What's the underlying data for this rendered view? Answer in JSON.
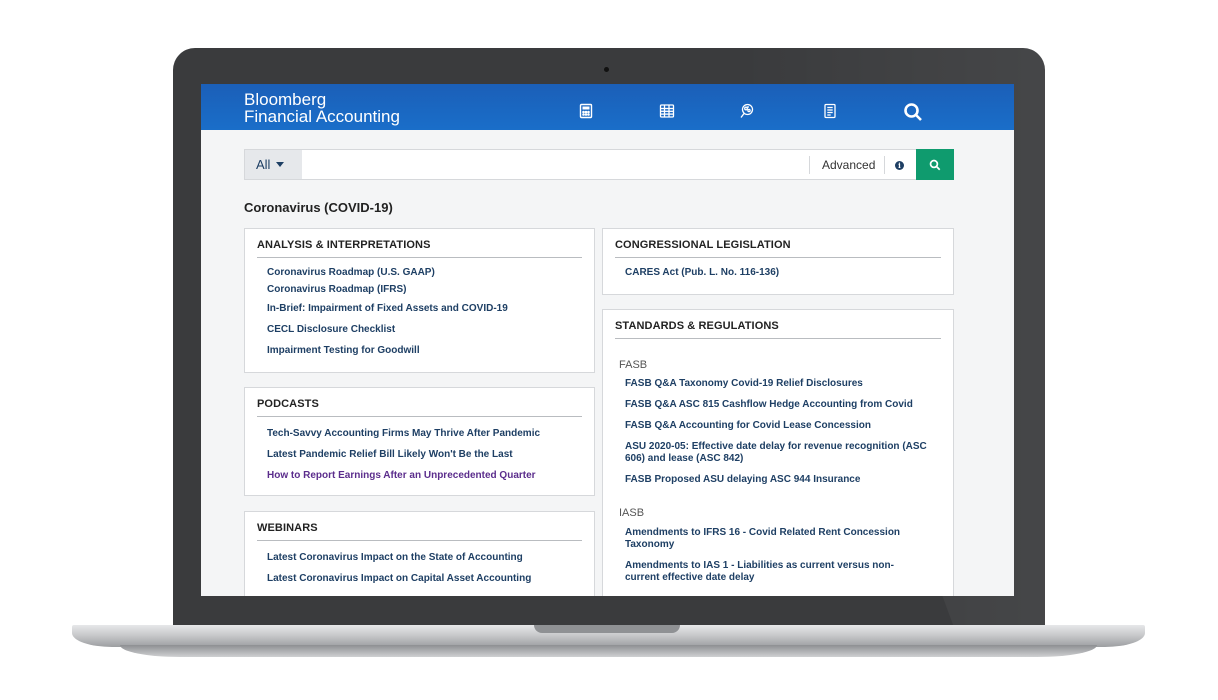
{
  "brand": {
    "line1": "Bloomberg",
    "line2": "Financial Accounting"
  },
  "nav_icons": [
    "calculator-icon",
    "table-icon",
    "brain-icon",
    "document-icon",
    "search-icon"
  ],
  "search": {
    "scope": "All",
    "placeholder": "",
    "advanced": "Advanced"
  },
  "page_title": "Coronavirus (COVID-19)",
  "analysis": {
    "heading": "ANALYSIS & INTERPRETATIONS",
    "links": [
      "Coronavirus Roadmap (U.S. GAAP)",
      "Coronavirus Roadmap (IFRS)",
      "In-Brief: Impairment of Fixed Assets and COVID-19",
      "CECL Disclosure Checklist",
      "Impairment Testing for Goodwill"
    ]
  },
  "podcasts": {
    "heading": "PODCASTS",
    "links": [
      "Tech-Savvy Accounting Firms May Thrive After Pandemic",
      "Latest Pandemic Relief Bill Likely Won't Be the Last",
      "How to Report Earnings After an Unprecedented Quarter"
    ]
  },
  "webinars": {
    "heading": "WEBINARS",
    "links": [
      "Latest Coronavirus Impact on the State of Accounting",
      "Latest Coronavirus Impact on Capital Asset Accounting"
    ]
  },
  "legislation": {
    "heading": "CONGRESSIONAL LEGISLATION",
    "links": [
      "CARES Act (Pub. L. No. 116-136)"
    ]
  },
  "standards": {
    "heading": "STANDARDS & REGULATIONS",
    "fasb": {
      "label": "FASB",
      "links": [
        "FASB Q&A Taxonomy Covid-19 Relief Disclosures",
        "FASB Q&A ASC 815 Cashflow Hedge Accounting from Covid",
        "FASB Q&A Accounting for Covid Lease Concession",
        "ASU 2020-05: Effective date delay for revenue recognition (ASC 606) and lease (ASC 842)",
        "FASB Proposed ASU delaying ASC 944 Insurance"
      ]
    },
    "iasb": {
      "label": "IASB",
      "links": [
        "Amendments to IFRS 16 - Covid Related Rent Concession Taxonomy",
        "Amendments to IAS 1 - Liabilities as current versus non-current effective date delay"
      ]
    }
  }
}
